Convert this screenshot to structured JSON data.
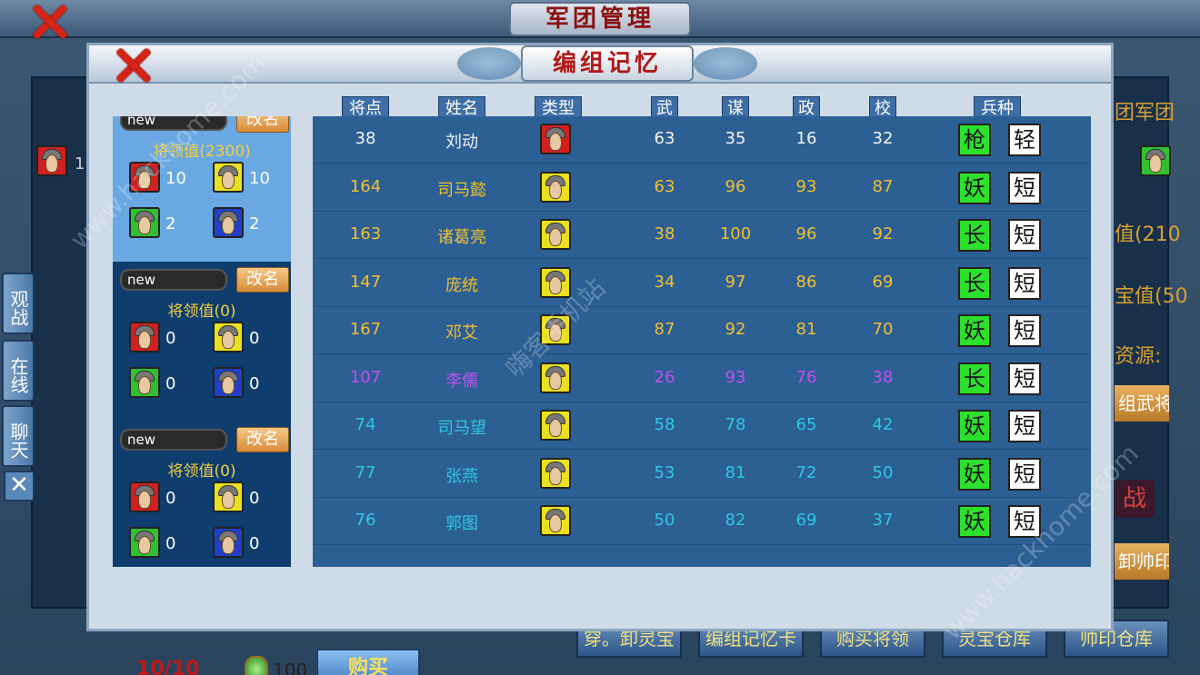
{
  "background": {
    "title": "军团管理",
    "right_texts": [
      "团军团",
      "值(210",
      "宝值(50",
      "资源:",
      "组武将",
      "卸帅印"
    ],
    "battle_label": "战",
    "left_avatar_count": "1",
    "bottom_buttons": [
      "穿。卸灵宝",
      "编组记忆卡",
      "购买将领",
      "灵宝仓库",
      "帅印仓库"
    ]
  },
  "side_buttons": [
    "观战",
    "在线",
    "聊天"
  ],
  "side_close_icon": "✕",
  "modal": {
    "title": "编组记忆",
    "headers": {
      "points": "将点",
      "name": "姓名",
      "type": "类型",
      "wu": "武",
      "mou": "谋",
      "zheng": "政",
      "xiao": "校",
      "troops": "兵种"
    },
    "groups": [
      {
        "name": "new",
        "rename": "改名",
        "leadership": "将领值(2300)",
        "counts": {
          "red": "10",
          "yellow": "10",
          "green": "2",
          "blue": "2"
        }
      },
      {
        "name": "new",
        "rename": "改名",
        "leadership": "将领值(0)",
        "counts": {
          "red": "0",
          "yellow": "0",
          "green": "0",
          "blue": "0"
        }
      },
      {
        "name": "new",
        "rename": "改名",
        "leadership": "将领值(0)",
        "counts": {
          "red": "0",
          "yellow": "0",
          "green": "0",
          "blue": "0"
        }
      }
    ],
    "generals": [
      {
        "points": "38",
        "name": "刘动",
        "type": "red",
        "wu": "63",
        "mou": "35",
        "zheng": "16",
        "xiao": "32",
        "troop1": "枪",
        "troop2": "轻",
        "color": "white"
      },
      {
        "points": "164",
        "name": "司马懿",
        "type": "yellow",
        "wu": "63",
        "mou": "96",
        "zheng": "93",
        "xiao": "87",
        "troop1": "妖",
        "troop2": "短",
        "color": "yellow"
      },
      {
        "points": "163",
        "name": "诸葛亮",
        "type": "yellow",
        "wu": "38",
        "mou": "100",
        "zheng": "96",
        "xiao": "92",
        "troop1": "长",
        "troop2": "短",
        "color": "yellow"
      },
      {
        "points": "147",
        "name": "庞统",
        "type": "yellow",
        "wu": "34",
        "mou": "97",
        "zheng": "86",
        "xiao": "69",
        "troop1": "长",
        "troop2": "短",
        "color": "yellow"
      },
      {
        "points": "167",
        "name": "邓艾",
        "type": "yellow",
        "wu": "87",
        "mou": "92",
        "zheng": "81",
        "xiao": "70",
        "troop1": "妖",
        "troop2": "短",
        "color": "yellow"
      },
      {
        "points": "107",
        "name": "李儒",
        "type": "yellow",
        "wu": "26",
        "mou": "93",
        "zheng": "76",
        "xiao": "38",
        "troop1": "长",
        "troop2": "短",
        "color": "purple"
      },
      {
        "points": "74",
        "name": "司马望",
        "type": "yellow",
        "wu": "58",
        "mou": "78",
        "zheng": "65",
        "xiao": "42",
        "troop1": "妖",
        "troop2": "短",
        "color": "cyan"
      },
      {
        "points": "77",
        "name": "张燕",
        "type": "yellow",
        "wu": "53",
        "mou": "81",
        "zheng": "72",
        "xiao": "50",
        "troop1": "妖",
        "troop2": "短",
        "color": "cyan"
      },
      {
        "points": "76",
        "name": "郭图",
        "type": "yellow",
        "wu": "50",
        "mou": "82",
        "zheng": "69",
        "xiao": "37",
        "troop1": "妖",
        "troop2": "短",
        "color": "cyan"
      }
    ],
    "count": "10/10",
    "currency": "100",
    "buy_label": "购买"
  },
  "watermarks": [
    "www.hackhome.com",
    "嗨客手机站",
    "www.hackhome.com"
  ]
}
